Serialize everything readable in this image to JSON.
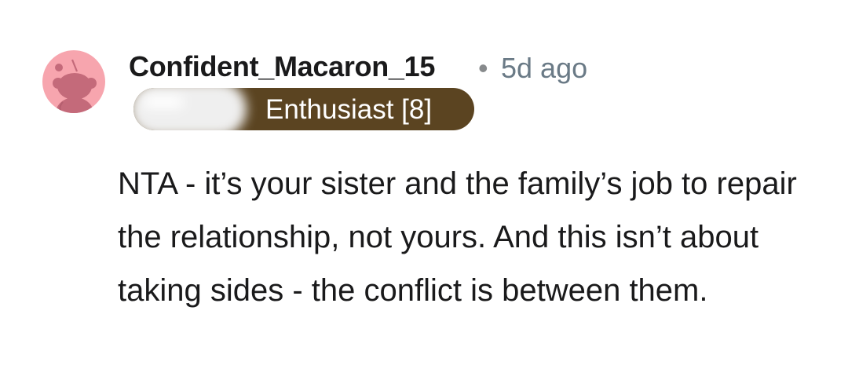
{
  "comment": {
    "author": {
      "username": "Confident_Macaron_15",
      "avatar_icon": "reddit-snoo-icon",
      "avatar_color": "#f7a5ae"
    },
    "separator": "•",
    "timestamp": "5d ago",
    "flair": {
      "text": "Enthusiast [8]",
      "background_color": "#5b4421"
    },
    "body": "NTA - it’s your sister and the family’s job to repair the relationship, not yours. And this isn’t about taking sides - the conflict is between them."
  }
}
